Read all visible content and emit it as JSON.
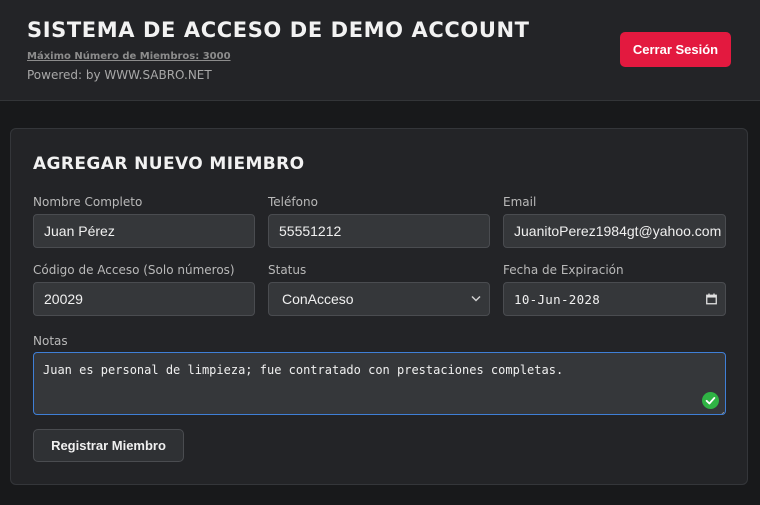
{
  "header": {
    "title": "SISTEMA DE ACCESO DE DEMO ACCOUNT",
    "max_members": "Máximo Número de Miembros: 3000",
    "powered_by": "Powered: by WWW.SABRO.NET",
    "logout_label": "Cerrar Sesión",
    "logout_color": "#e3193f"
  },
  "form": {
    "title": "AGREGAR NUEVO MIEMBRO",
    "fields": {
      "name": {
        "label": "Nombre Completo",
        "value": "Juan Pérez"
      },
      "phone": {
        "label": "Teléfono",
        "value": "55551212"
      },
      "email": {
        "label": "Email",
        "value": "JuanitoPerez1984gt@yahoo.com"
      },
      "access_code": {
        "label": "Código de Acceso (Solo números)",
        "value": "20029"
      },
      "status": {
        "label": "Status",
        "value": "ConAcceso",
        "icon": "chevron-down-icon"
      },
      "expiration": {
        "label": "Fecha de Expiración",
        "value": "10-Jun-2028",
        "icon": "calendar-icon"
      }
    },
    "notes": {
      "label": "Notas",
      "value": "Juan es personal de limpieza; fue contratado con prestaciones completas.",
      "validation_icon": "check-circle-icon",
      "validation_color": "#2fb344"
    },
    "submit_label": "Registrar Miembro"
  }
}
